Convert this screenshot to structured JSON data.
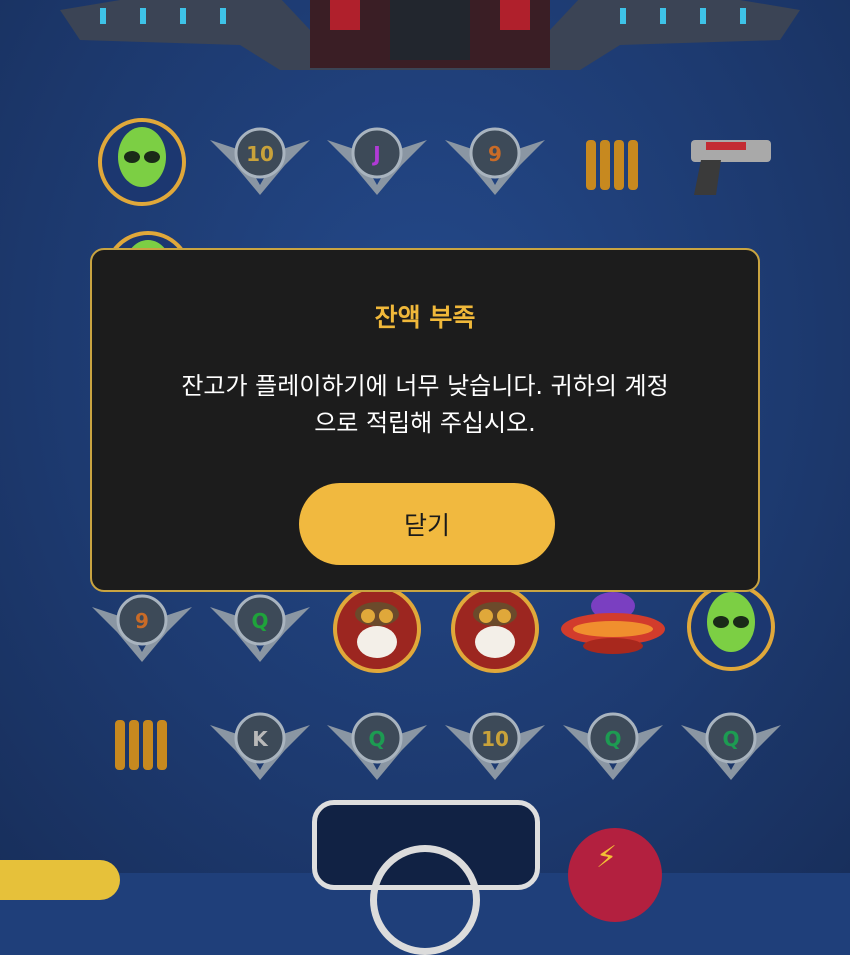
{
  "dialog": {
    "title": "잔액 부족",
    "message_line1": "잔고가 플레이하기에 너무 낮습니다. 귀하의 계정",
    "message_line2": "으로 적립해 주십시오.",
    "close_label": "닫기"
  },
  "reels": {
    "row1": [
      {
        "kind": "alien",
        "icon": "alien-icon"
      },
      {
        "kind": "badge",
        "label": "10",
        "color": "gold"
      },
      {
        "kind": "badge",
        "label": "J",
        "color": "purple"
      },
      {
        "kind": "badge",
        "label": "9",
        "color": "orange"
      },
      {
        "kind": "ammo",
        "icon": "ammo-icon"
      },
      {
        "kind": "gun",
        "icon": "blaster-icon"
      }
    ],
    "row5": [
      {
        "kind": "badge",
        "label": "9",
        "color": "orange"
      },
      {
        "kind": "badge",
        "label": "Q",
        "color": "green"
      },
      {
        "kind": "pilot",
        "icon": "pilot-icon"
      },
      {
        "kind": "pilot",
        "icon": "pilot-icon"
      },
      {
        "kind": "ufo",
        "icon": "ufo-icon"
      },
      {
        "kind": "alien",
        "icon": "alien-icon"
      }
    ],
    "row6": [
      {
        "kind": "ammo",
        "icon": "ammo-icon"
      },
      {
        "kind": "badge",
        "label": "K",
        "color": "gray"
      },
      {
        "kind": "badge",
        "label": "Q",
        "color": "teal"
      },
      {
        "kind": "badge",
        "label": "10",
        "color": "gold"
      },
      {
        "kind": "badge",
        "label": "Q",
        "color": "teal"
      },
      {
        "kind": "badge",
        "label": "Q",
        "color": "teal"
      }
    ]
  },
  "controls": {
    "spin_icon": "spin-icon",
    "turbo_icon": "lightning-icon",
    "accent": "#f1b93f",
    "dialog_border": "#c9a441",
    "title_color": "#f0b83a"
  }
}
